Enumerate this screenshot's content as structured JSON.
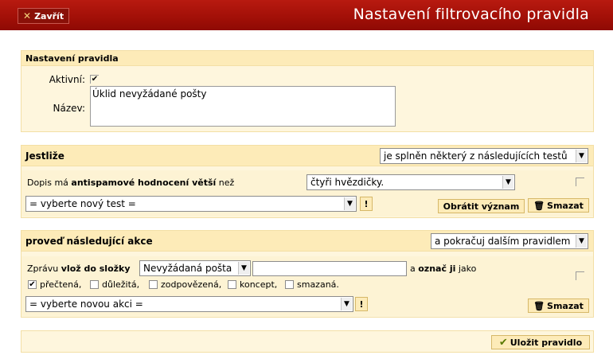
{
  "header": {
    "close_label": "Zavřít",
    "title": "Nastavení filtrovacího pravidla"
  },
  "rule": {
    "section_title": "Nastavení pravidla",
    "active_label": "Aktivní:",
    "active_checked": true,
    "name_label": "Název:",
    "name_value": "Úklid nevyžádané pošty"
  },
  "conditions": {
    "section_title": "Jestliže",
    "match_select": "je splněn některý z následujících testů",
    "test": {
      "prefix": "Dopis má ",
      "bold": "antispamové hodnocení větší",
      "suffix": " než",
      "value_select": "čtyři hvězdičky."
    },
    "new_test_select": "= vyberte nový test =",
    "invert_label": "Obrátit význam",
    "delete_label": "Smazat",
    "excl_label": "!"
  },
  "actions": {
    "section_title": "proveď následující akce",
    "continue_select": "a pokračuj dalším pravidlem",
    "action": {
      "prefix": "Zprávu ",
      "bold": "vlož do složky",
      "folder_select": "Nevyžádaná pošta",
      "mid": " a ",
      "bold2": "označ ji",
      "suffix": " jako",
      "flags": [
        {
          "label": "přečtená,",
          "checked": true
        },
        {
          "label": "důležitá,",
          "checked": false
        },
        {
          "label": "zodpovězená,",
          "checked": false
        },
        {
          "label": "koncept,",
          "checked": false
        },
        {
          "label": "smazaná.",
          "checked": false
        }
      ]
    },
    "new_action_select": "= vyberte novou akci =",
    "delete_label": "Smazat",
    "excl_label": "!"
  },
  "footer": {
    "save_label": "Uložit pravidlo"
  }
}
